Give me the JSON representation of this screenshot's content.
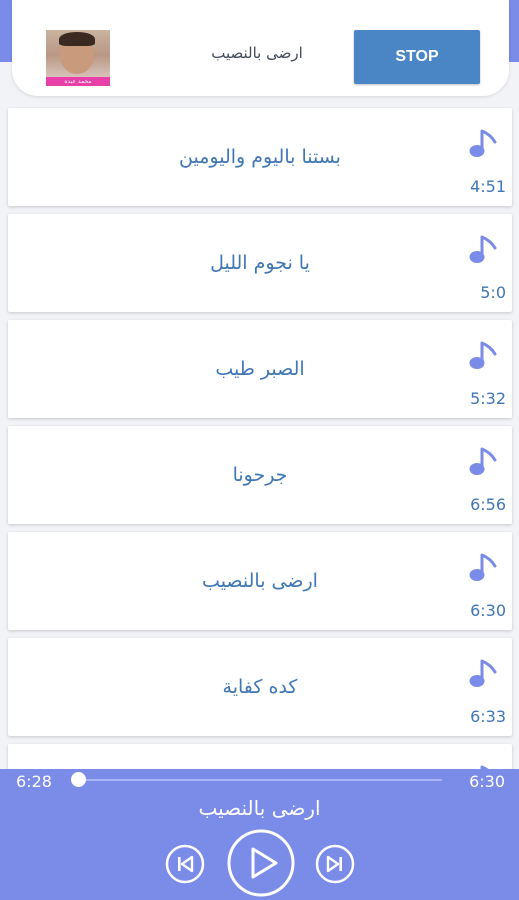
{
  "now_playing": {
    "title": "ارضى بالنصيب",
    "stop_label": "STOP",
    "thumb_caption": "محمد عبده"
  },
  "songs": [
    {
      "title": "بستنا باليوم واليومين",
      "duration": "4:51"
    },
    {
      "title": "يا نجوم الليل",
      "duration": "5:0"
    },
    {
      "title": "الصبر طيب",
      "duration": "5:32"
    },
    {
      "title": "جرحونا",
      "duration": "6:56"
    },
    {
      "title": "ارضى بالنصيب",
      "duration": "6:30"
    },
    {
      "title": "كده كفاية",
      "duration": "6:33"
    }
  ],
  "player": {
    "current_time": "6:28",
    "total_time": "6:30",
    "progress": 0.0,
    "title": "ارضى بالنصيب"
  },
  "icons": {
    "song": "music-note-icon",
    "prev": "skip-previous-icon",
    "play": "play-icon",
    "next": "skip-next-icon"
  },
  "colors": {
    "accent": "#7b8be8",
    "stop_button": "#4a86c6",
    "song_text": "#3f76b5",
    "note_icon": "#7b8be8"
  }
}
